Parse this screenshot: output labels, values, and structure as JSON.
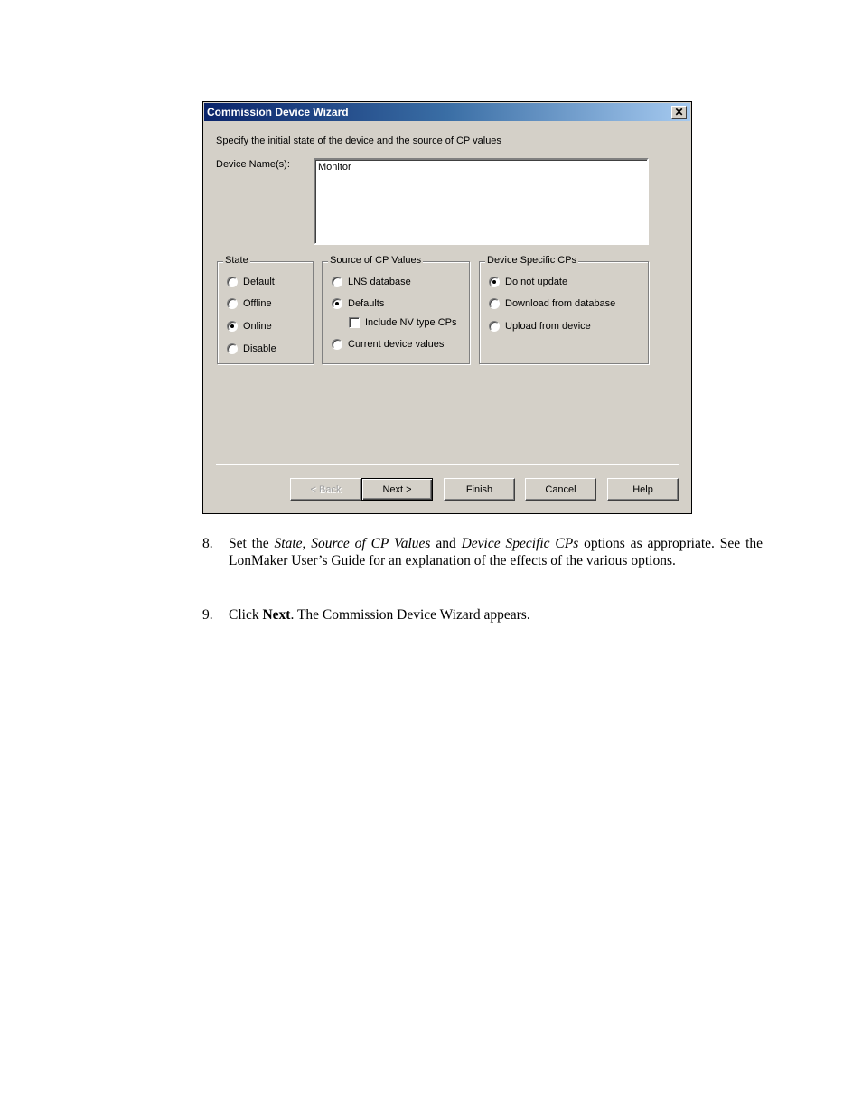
{
  "dialog": {
    "title": "Commission Device Wizard",
    "close_icon": "close-icon",
    "instruction": "Specify the initial state of the device and the source of CP values",
    "device_names_label": "Device Name(s):",
    "device_names_value": "Monitor",
    "state": {
      "legend": "State",
      "options": [
        {
          "label": "Default",
          "selected": false
        },
        {
          "label": "Offline",
          "selected": false
        },
        {
          "label": "Online",
          "selected": true
        },
        {
          "label": "Disable",
          "selected": false
        }
      ]
    },
    "source": {
      "legend": "Source of CP Values",
      "options": [
        {
          "label": "LNS database",
          "selected": false
        },
        {
          "label": "Defaults",
          "selected": true
        },
        {
          "label": "Current device values",
          "selected": false
        }
      ],
      "include_nv_label": "Include NV type CPs",
      "include_nv_checked": false
    },
    "device_cps": {
      "legend": "Device Specific CPs",
      "options": [
        {
          "label": "Do not update",
          "selected": true
        },
        {
          "label": "Download from database",
          "selected": false
        },
        {
          "label": "Upload from device",
          "selected": false
        }
      ]
    },
    "buttons": {
      "back": "< Back",
      "next": "Next >",
      "finish": "Finish",
      "cancel": "Cancel",
      "help": "Help"
    }
  },
  "document": {
    "step8": {
      "number": "8.",
      "p1": "Set the ",
      "i1": "State",
      "p2": ", ",
      "i2": "Source of CP Values",
      "p3": " and ",
      "i3": "Device Specific CPs",
      "p4": " options as appropriate.  See the LonMaker User’s Guide for an explanation of the effects of the various options."
    },
    "step9": {
      "number": "9.",
      "p1": "Click ",
      "b1": "Next",
      "p2": ".  The Commission Device Wizard appears."
    }
  }
}
